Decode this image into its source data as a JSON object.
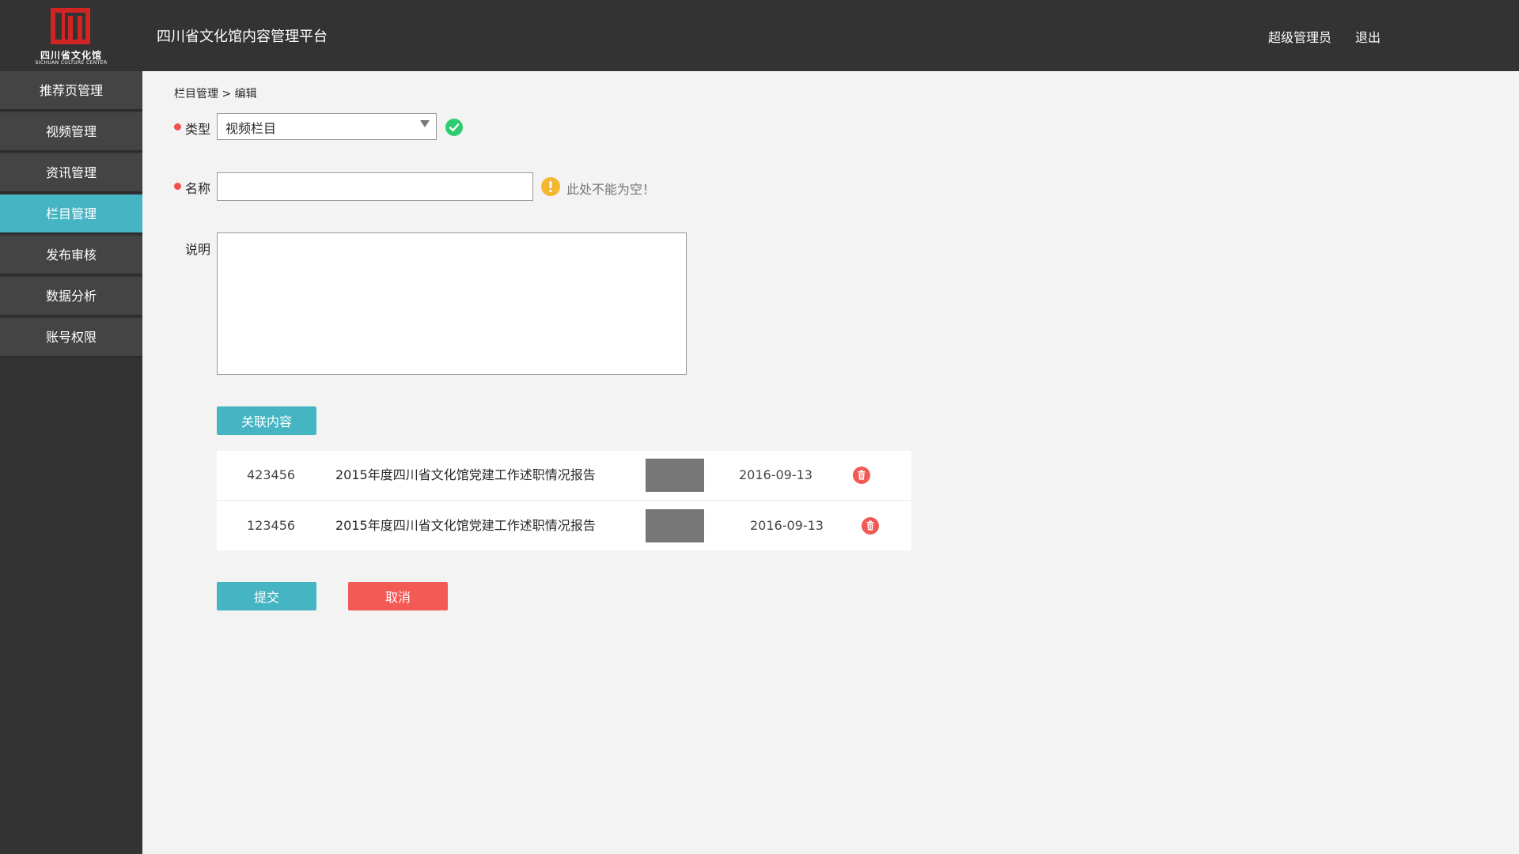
{
  "header": {
    "logo_cn": "四川省文化馆",
    "logo_en": "SICHUAN CULTURE CENTER",
    "platform_title": "四川省文化馆内容管理平台",
    "user_name": "超级管理员",
    "logout": "退出"
  },
  "sidebar": {
    "items": [
      {
        "label": "推荐页管理"
      },
      {
        "label": "视频管理"
      },
      {
        "label": "资讯管理"
      },
      {
        "label": "栏目管理"
      },
      {
        "label": "发布审核"
      },
      {
        "label": "数据分析"
      },
      {
        "label": "账号权限"
      }
    ],
    "active_index": 3
  },
  "breadcrumb": "栏目管理 > 编辑",
  "form": {
    "type_label": "类型",
    "type_value": "视频栏目",
    "name_label": "名称",
    "name_value": "",
    "name_error": "此处不能为空！",
    "desc_label": "说明",
    "desc_value": ""
  },
  "buttons": {
    "link_content": "关联内容",
    "submit": "提交",
    "cancel": "取消"
  },
  "related": [
    {
      "id": "423456",
      "title": "2015年度四川省文化馆党建工作述职情况报告",
      "date": "2016-09-13"
    },
    {
      "id": "123456",
      "title": "2015年度四川省文化馆党建工作述职情况报告",
      "date": "2016-09-13"
    }
  ],
  "colors": {
    "header_bg": "#333333",
    "accent": "#45b5c4",
    "danger": "#f45a55",
    "success": "#2ecc71",
    "warning": "#f5b731"
  }
}
